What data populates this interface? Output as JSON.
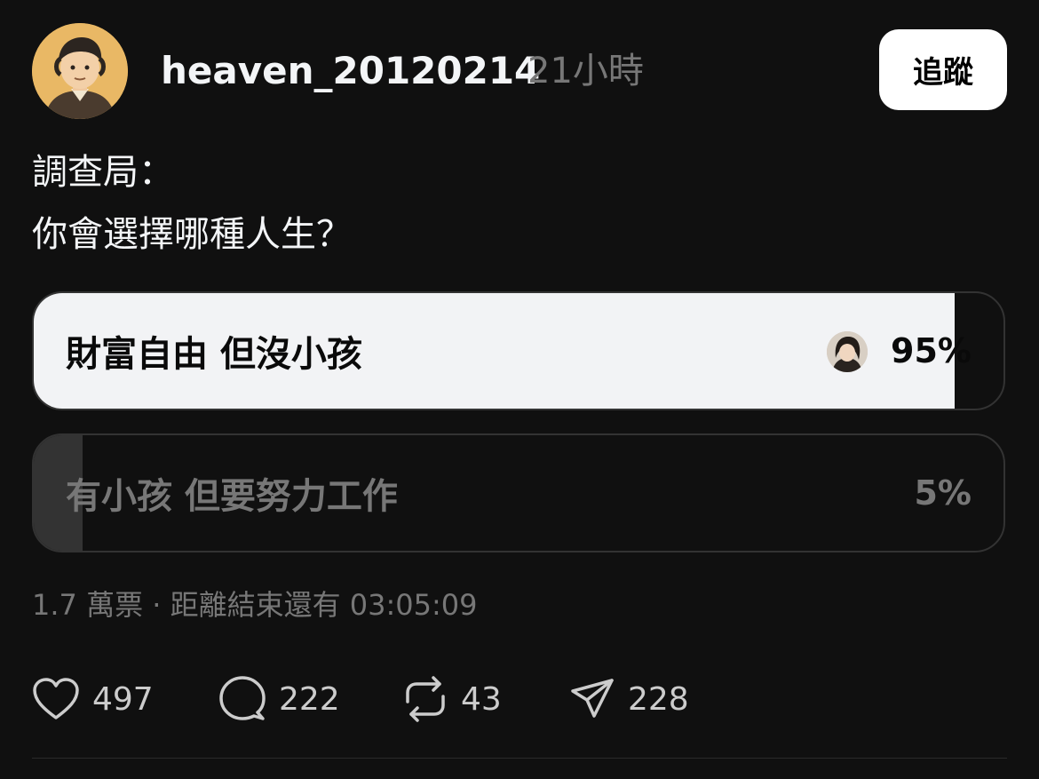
{
  "post": {
    "username": "heaven_20120214",
    "time": "21小時",
    "follow_label": "追蹤",
    "text_line1": "調查局：",
    "text_line2": "你會選擇哪種人生？"
  },
  "poll": {
    "options": [
      {
        "label": "財富自由 但沒小孩",
        "percent_text": "95%",
        "share": 0.95
      },
      {
        "label": "有小孩 但要努力工作",
        "percent_text": "5%",
        "share": 0.05
      }
    ],
    "meta": "1.7 萬票 · 距離結束還有 03:05:09"
  },
  "actions": {
    "likes": "497",
    "replies": "222",
    "reposts": "43",
    "shares": "228"
  },
  "icons": {
    "like": "heart-icon",
    "reply": "speech-bubble-icon",
    "repost": "repost-icon",
    "share": "paper-plane-icon"
  },
  "colors": {
    "background": "#101010",
    "winning_bar": "#f2f3f5",
    "losing_bar": "#333333",
    "muted_text": "#777777"
  }
}
